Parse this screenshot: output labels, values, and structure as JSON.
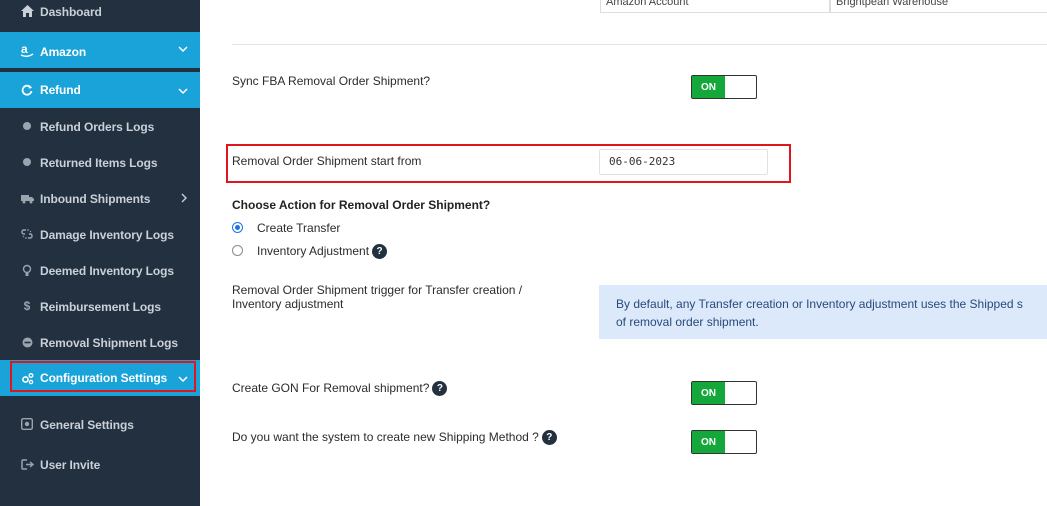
{
  "sidebar": {
    "items": [
      {
        "label": "Dashboard",
        "icon": "home-icon"
      },
      {
        "label": "Amazon",
        "icon": "amazon-icon"
      },
      {
        "label": "Refund",
        "icon": "refresh-icon"
      },
      {
        "label": "Refund Orders Logs",
        "icon": "dot-icon"
      },
      {
        "label": "Returned Items Logs",
        "icon": "dot-icon"
      },
      {
        "label": "Inbound Shipments",
        "icon": "truck-icon"
      },
      {
        "label": "Damage Inventory Logs",
        "icon": "broken-link-icon"
      },
      {
        "label": "Deemed Inventory Logs",
        "icon": "lightbulb-icon"
      },
      {
        "label": "Reimbursement Logs",
        "icon": "dollar-icon"
      },
      {
        "label": "Removal Shipment Logs",
        "icon": "minus-circle-icon"
      },
      {
        "label": "Configuration Settings",
        "icon": "gears-icon"
      },
      {
        "label": "General Settings",
        "icon": "settings-box-icon"
      },
      {
        "label": "User Invite",
        "icon": "user-invite-icon"
      }
    ]
  },
  "top_row": {
    "cell1": "Amazon Account",
    "cell2": "Brightpearl Warehouse"
  },
  "form": {
    "sync_fba_label": "Sync FBA Removal Order Shipment?",
    "sync_fba_toggle": "ON",
    "start_from_label": "Removal Order Shipment start from",
    "start_from_value": "06-06-2023",
    "choose_action_label": "Choose Action for Removal Order Shipment?",
    "option_create_transfer": "Create Transfer",
    "option_inventory_adjustment": "Inventory Adjustment",
    "trigger_label_line1": "Removal Order Shipment trigger for Transfer creation /",
    "trigger_label_line2": "Inventory adjustment",
    "info_line1": "By default, any Transfer creation or Inventory adjustment uses the Shipped s",
    "info_line2": "of removal order shipment.",
    "gon_label": "Create GON For Removal shipment?",
    "gon_toggle": "ON",
    "shipping_method_label": "Do you want the system to create new Shipping Method ?",
    "shipping_method_toggle": "ON",
    "help_glyph": "?"
  },
  "colors": {
    "sidebar_bg": "#22303f",
    "active_bg": "#1aa3d9",
    "toggle_on": "#14a83b",
    "highlight": "#e0161e",
    "info_bg": "#dbe9fb"
  }
}
